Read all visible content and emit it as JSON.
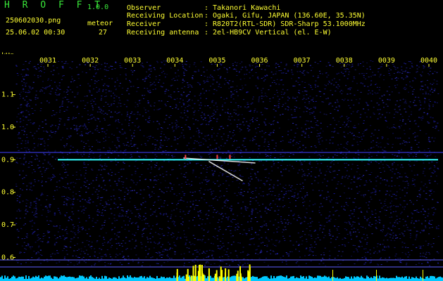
{
  "app": {
    "name": "H R O F F T",
    "version": "1.0.0"
  },
  "file": {
    "name": "250602030.png",
    "datetime": "25.06.02 00:30",
    "meteor_label": "meteor",
    "meteor_count": "27"
  },
  "station": {
    "rows": [
      {
        "label": "Observer",
        "value": ": Takanori Kawachi"
      },
      {
        "label": "Receiving Location",
        "value": ": Ogaki, Gifu, JAPAN (136.60E, 35.35N)"
      },
      {
        "label": "Receiver",
        "value": ": R820T2(RTL-SDR) SDR-Sharp 53.1000MHz"
      },
      {
        "label": "Receiving antenna",
        "value": ": 2el-HB9CV Vertical (el. E-W)"
      }
    ]
  },
  "axis": {
    "unit": "kHz",
    "time_ticks": [
      "0031",
      "0032",
      "0033",
      "0034",
      "0035",
      "0036",
      "0037",
      "0038",
      "0039",
      "0040"
    ],
    "freq_ticks": [
      "1.1",
      "1.0",
      "0.9",
      "0.8",
      "0.7",
      "0.6"
    ]
  },
  "colors": {
    "background": "#000000",
    "header_text": "#ffff33",
    "title_text": "#39e639",
    "noise": "#1a1a8c",
    "carrier": "#00ffff",
    "meteor": "#ffffff",
    "level_bar": "#00c8ff",
    "level_peak": "#ffff00"
  },
  "chart_data": {
    "type": "heatmap",
    "x_unit": "minutes (hhmm)",
    "y_unit": "kHz",
    "ylim": [
      0.575,
      1.205
    ],
    "carrier_freq_khz": 0.9,
    "meteor_traces": [
      {
        "start_time": "0034.2",
        "end_time": "0035.9",
        "freq_start": 0.905,
        "freq_end": 0.89
      },
      {
        "start_time": "0034.8",
        "end_time": "0035.6",
        "freq_start": 0.895,
        "freq_end": 0.835
      }
    ],
    "meteor_count": 27
  }
}
